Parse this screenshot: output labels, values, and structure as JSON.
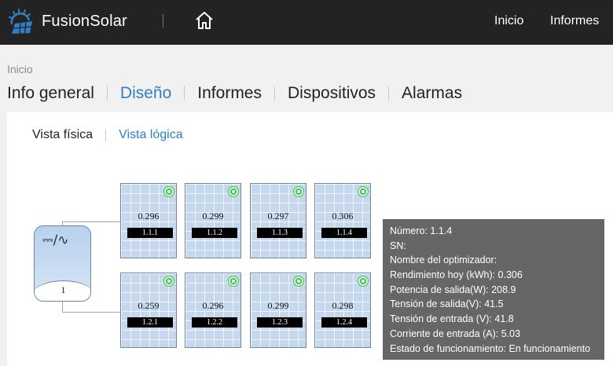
{
  "header": {
    "brand": "FusionSolar",
    "logo_icon": "fusionsolar-sun-panel-logo",
    "home_icon": "home-icon",
    "nav": [
      "Inicio",
      "Informes"
    ]
  },
  "breadcrumb": "Inicio",
  "tabs": [
    "Info general",
    "Diseño",
    "Informes",
    "Dispositivos",
    "Alarmas"
  ],
  "active_tab": "Diseño",
  "subtabs": [
    "Vista física",
    "Vista lógica"
  ],
  "inverter": {
    "icon": "dc-ac-inverter-icon",
    "symbol": "⎓/∿",
    "number": "1"
  },
  "rows": [
    {
      "modules": [
        {
          "power": "0.296",
          "id": "1.1.1",
          "status": "green"
        },
        {
          "power": "0.299",
          "id": "1.1.2",
          "status": "green"
        },
        {
          "power": "0.297",
          "id": "1.1.3",
          "status": "green"
        },
        {
          "power": "0.306",
          "id": "1.1.4",
          "status": "green"
        }
      ]
    },
    {
      "modules": [
        {
          "power": "0.259",
          "id": "1.2.1",
          "status": "green"
        },
        {
          "power": "0.296",
          "id": "1.2.2",
          "status": "green"
        },
        {
          "power": "0.299",
          "id": "1.2.3",
          "status": "green"
        },
        {
          "power": "0.298",
          "id": "1.2.4",
          "status": "green"
        }
      ]
    }
  ],
  "tooltip": [
    "Número: 1.1.4",
    "SN:",
    "Nombre del optimizador:",
    "Rendimiento hoy (kWh): 0.306",
    "Potencia de salida(W): 208.9",
    "Tensión de salida(V): 41.5",
    "Tensión de entrada (V): 41.8",
    "Corriente de entrada (A): 5.03",
    "Estado de funcionamiento: En funcionamiento"
  ],
  "colors": {
    "topbar": "#232323",
    "accent": "#2f7fc1",
    "module_fill": "#c5d8ee",
    "status_ok": "#3fbf55",
    "tooltip_bg": "#606060"
  }
}
